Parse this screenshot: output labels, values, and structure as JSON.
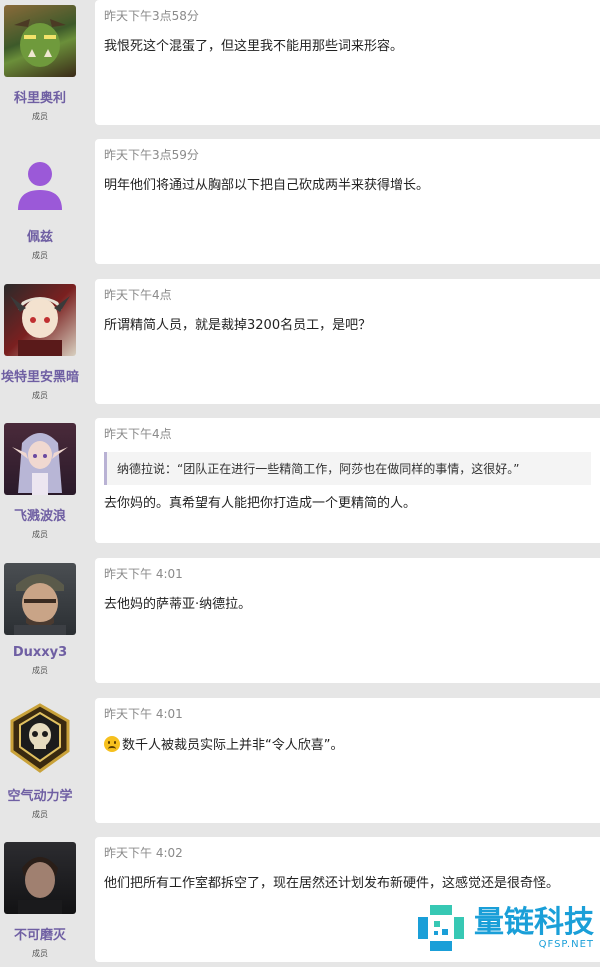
{
  "posts": [
    {
      "username": "科里奥利",
      "role": "成员",
      "timestamp": "昨天下午3点58分",
      "text": "我恨死这个混蛋了，但这里我不能用那些词来形容。"
    },
    {
      "username": "佩兹",
      "role": "成员",
      "timestamp": "昨天下午3点59分",
      "text": "明年他们将通过从胸部以下把自己砍成两半来获得增长。"
    },
    {
      "username": "埃特里安黑暗",
      "role": "成员",
      "timestamp": "昨天下午4点",
      "text": "所谓精简人员，就是裁掉3200名员工，是吧？"
    },
    {
      "username": "飞溅波浪",
      "role": "成员",
      "timestamp": "昨天下午4点",
      "quote": "纳德拉说：“团队正在进行一些精简工作，阿莎也在做同样的事情，这很好。”",
      "text": "去你妈的。真希望有人能把你打造成一个更精简的人。"
    },
    {
      "username": "Duxxy3",
      "role": "成员",
      "timestamp": "昨天下午 4:01",
      "text": "去他妈的萨蒂亚·纳德拉。"
    },
    {
      "username": "空气动力学",
      "role": "成员",
      "timestamp": "昨天下午 4:01",
      "text": "数千人被裁员实际上并非“令人欣喜”。",
      "emoji": "frowning-face"
    },
    {
      "username": "不可磨灭",
      "role": "成员",
      "timestamp": "昨天下午 4:02",
      "text": "他们把所有工作室都拆空了，现在居然还计划发布新硬件，这感觉还是很奇怪。"
    }
  ],
  "watermark": {
    "main": "量链科技",
    "sub": "QFSP.NET"
  },
  "colors": {
    "username": "#6f5fa3",
    "background": "#e6e6e6",
    "card": "#ffffff",
    "watermark": "#1a9fd8"
  }
}
